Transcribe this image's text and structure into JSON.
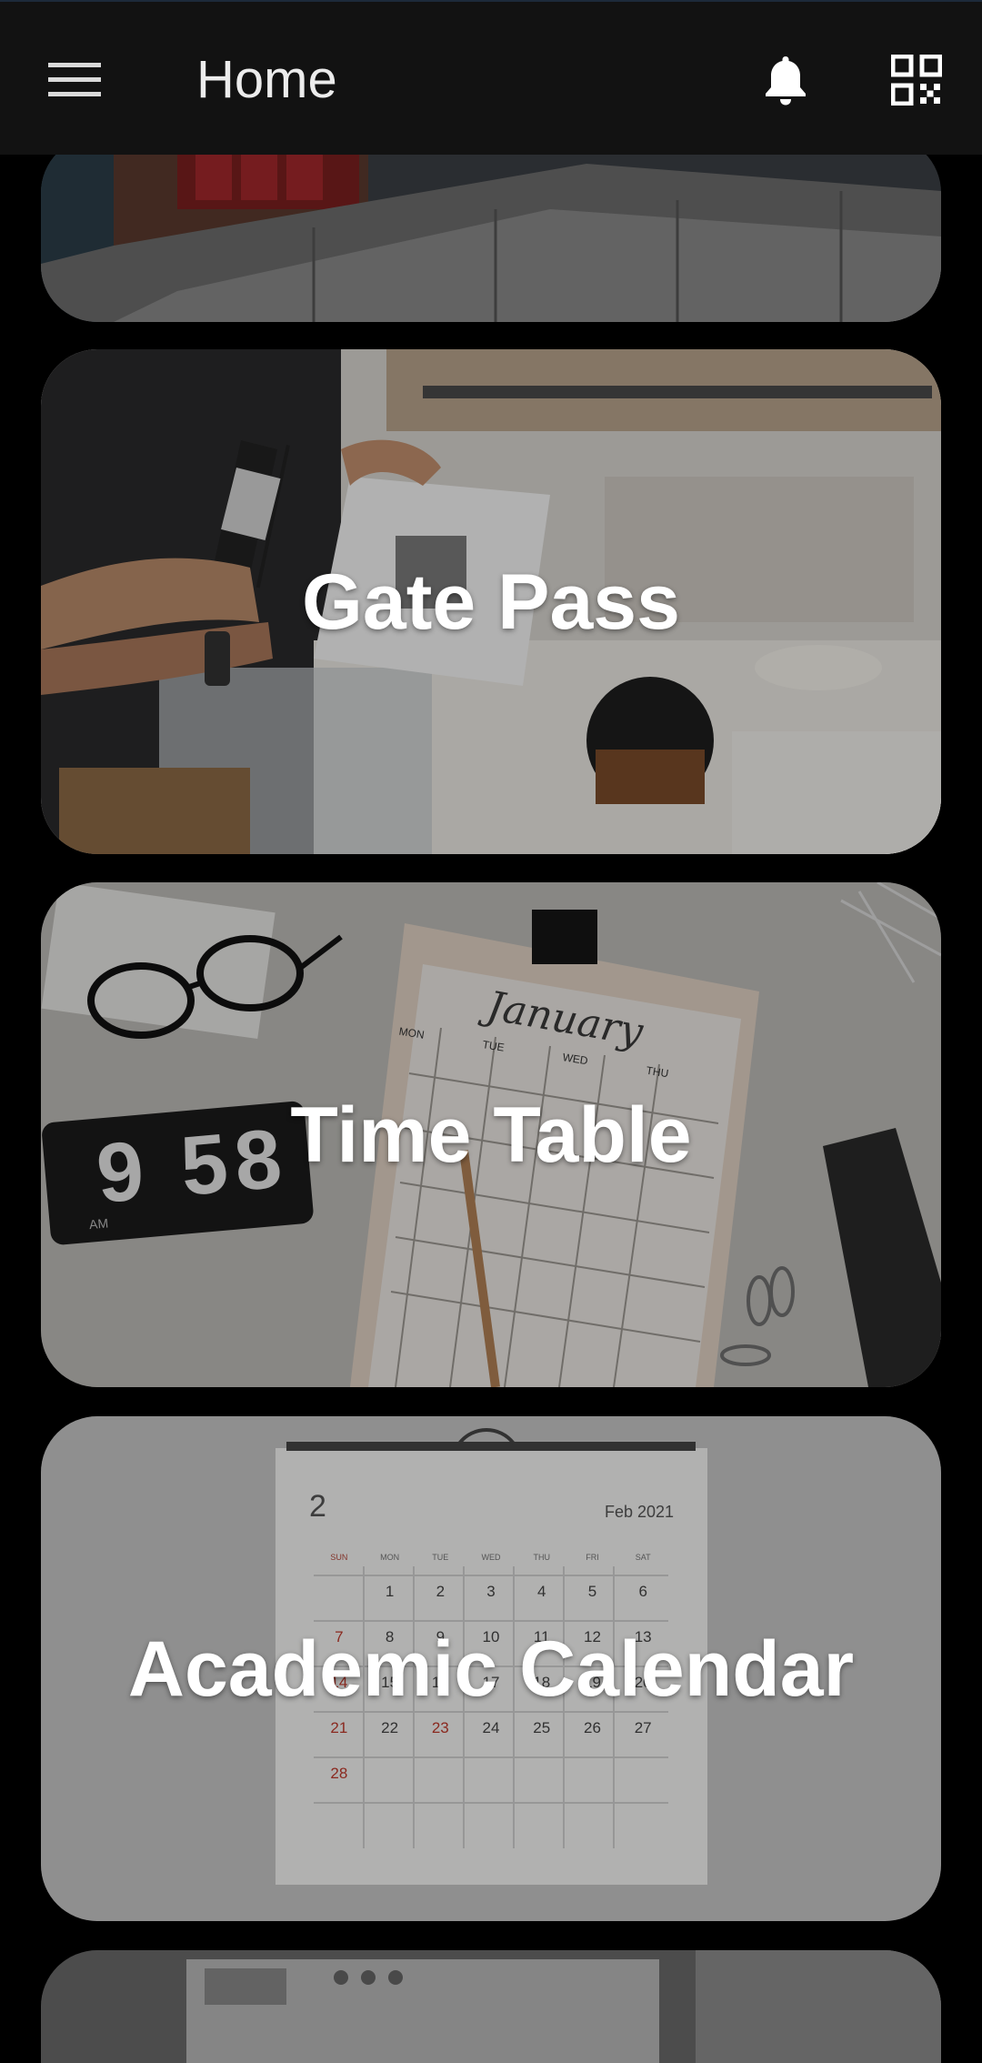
{
  "appbar": {
    "title": "Home",
    "menu_icon": "hamburger-menu-icon",
    "notification_icon": "bell-icon",
    "qr_icon": "qr-code-icon"
  },
  "cards": [
    {
      "label": ""
    },
    {
      "label": "Gate Pass"
    },
    {
      "label": "Time Table"
    },
    {
      "label": "Academic Calendar"
    },
    {
      "label": ""
    }
  ],
  "time_table_art": {
    "clock_time": "9 58",
    "clock_suffix": "AM",
    "month": "January",
    "weekdays": [
      "MON",
      "TUE",
      "WED",
      "THU"
    ]
  },
  "academic_calendar_art": {
    "month_number": "2",
    "month_title": "Feb 2021",
    "weekdays": [
      "SUN",
      "MON",
      "TUE",
      "WED",
      "THU",
      "FRI",
      "SAT"
    ],
    "rows": [
      [
        "",
        "1",
        "2",
        "3",
        "4",
        "5",
        "6"
      ],
      [
        "7",
        "8",
        "9",
        "10",
        "11",
        "12",
        "13"
      ],
      [
        "14",
        "15",
        "16",
        "17",
        "18",
        "19",
        "20"
      ],
      [
        "21",
        "22",
        "23",
        "24",
        "25",
        "26",
        "27"
      ],
      [
        "28",
        "",
        "",
        "",
        "",
        "",
        ""
      ]
    ]
  },
  "colors": {
    "appbar_bg": "#121212",
    "page_bg": "#000000",
    "label": "#ffffff",
    "calendar_red": "#c0392b"
  }
}
